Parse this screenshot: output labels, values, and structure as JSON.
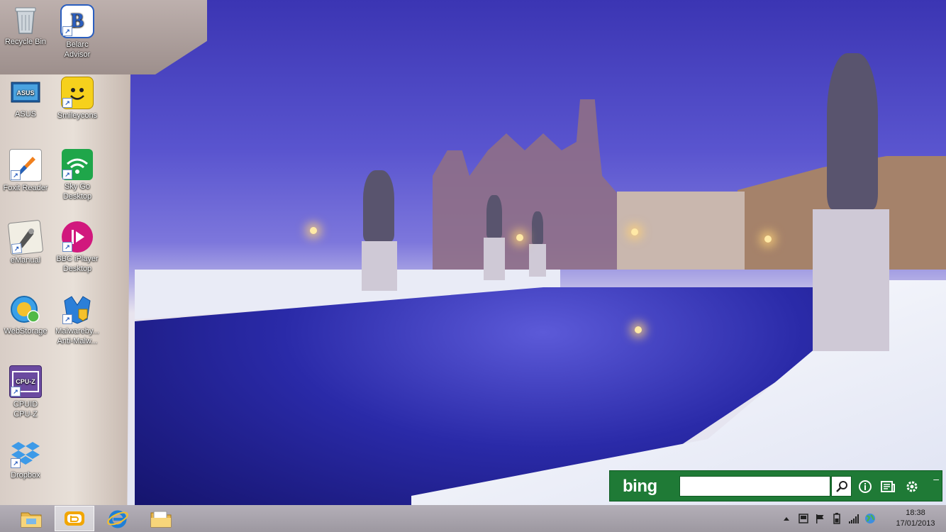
{
  "desktop": {
    "icons": [
      {
        "name": "recycle-bin",
        "label": "Recycle Bin",
        "icon": "recycle-bin-icon"
      },
      {
        "name": "belarc-advisor",
        "label": "Belarc\nAdvisor",
        "icon": "belarc-icon"
      },
      {
        "name": "asus",
        "label": "ASUS",
        "icon": "asus-icon"
      },
      {
        "name": "smileycons",
        "label": "Smileycons",
        "icon": "smiley-icon"
      },
      {
        "name": "foxit-reader",
        "label": "Foxit Reader",
        "icon": "foxit-icon"
      },
      {
        "name": "sky-go-desktop",
        "label": "Sky Go\nDesktop",
        "icon": "sky-go-icon"
      },
      {
        "name": "emanual",
        "label": "eManual",
        "icon": "emanual-icon"
      },
      {
        "name": "bbc-iplayer-desktop",
        "label": "BBC iPlayer\nDesktop",
        "icon": "iplayer-icon"
      },
      {
        "name": "webstorage",
        "label": "WebStorage",
        "icon": "webstorage-icon"
      },
      {
        "name": "malwarebytes",
        "label": "Malwareby...\nAnti-Malw...",
        "icon": "malwarebytes-icon"
      },
      {
        "name": "cpuid-cpuz",
        "label": "CPUID\nCPU-Z",
        "icon": "cpuz-icon"
      },
      {
        "name": "dropbox",
        "label": "Dropbox",
        "icon": "dropbox-icon"
      }
    ],
    "belarc_letter": "B",
    "cpuz_text": "CPU-Z"
  },
  "bingbar": {
    "logo": "bing",
    "search_value": "",
    "search_placeholder": "",
    "colors": {
      "bar": "#1f7a36"
    }
  },
  "taskbar": {
    "apps": [
      "file-explorer-icon",
      "bing-app-icon",
      "internet-explorer-icon",
      "windows-explorer-icon"
    ],
    "tray": [
      "show-hidden-icons",
      "action-center-icon",
      "flag-icon",
      "battery-icon",
      "network-signal-icon",
      "globe-icon"
    ],
    "clock": {
      "time": "18:38",
      "date": "17/01/2013"
    }
  }
}
